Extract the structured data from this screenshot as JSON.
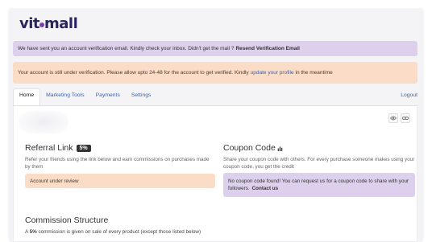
{
  "header": {
    "logo_part1": "vit",
    "logo_part2": "mall"
  },
  "alerts": {
    "verification": {
      "text": "We have sent you an account verification email. Kindly check your inbox. Didn't get the mail ?",
      "link": "Resend Verification Email"
    },
    "pending": {
      "text_before": "Your account is still under verification. Please allow upto 24-48 for the account to get verified. Kindly",
      "link": "update your profile",
      "text_after": "in the meantime"
    }
  },
  "tabs": [
    {
      "label": "Home",
      "active": true
    },
    {
      "label": "Marketing Tools",
      "active": false
    },
    {
      "label": "Payments",
      "active": false
    },
    {
      "label": "Settings",
      "active": false
    }
  ],
  "logout_label": "Logout",
  "referral": {
    "title": "Referral Link",
    "badge": "5%",
    "description": "Refer your friends using the link below and earn commissions on purchases made by them",
    "status": "Account under review"
  },
  "coupon": {
    "title": "Coupon Code",
    "description": "Share your coupon code with others. For every purchase someone makes using your coupon code, you get the credit",
    "notice": "No coupon code found! You can request us for a coupon code to share with your followers.",
    "contact": "Contact us"
  },
  "commission": {
    "title": "Commission Structure",
    "text_before": "A",
    "percent": "5%",
    "text_after": "commission is given on sale of every product (except those listed below)"
  },
  "colors": {
    "accent_link": "#3a62b3",
    "verify_bg": "#ddd0ec",
    "pending_bg": "#fbdcc7",
    "logo": "#2a2460"
  },
  "icons": [
    "eye-icon",
    "link-icon",
    "chart-icon"
  ]
}
